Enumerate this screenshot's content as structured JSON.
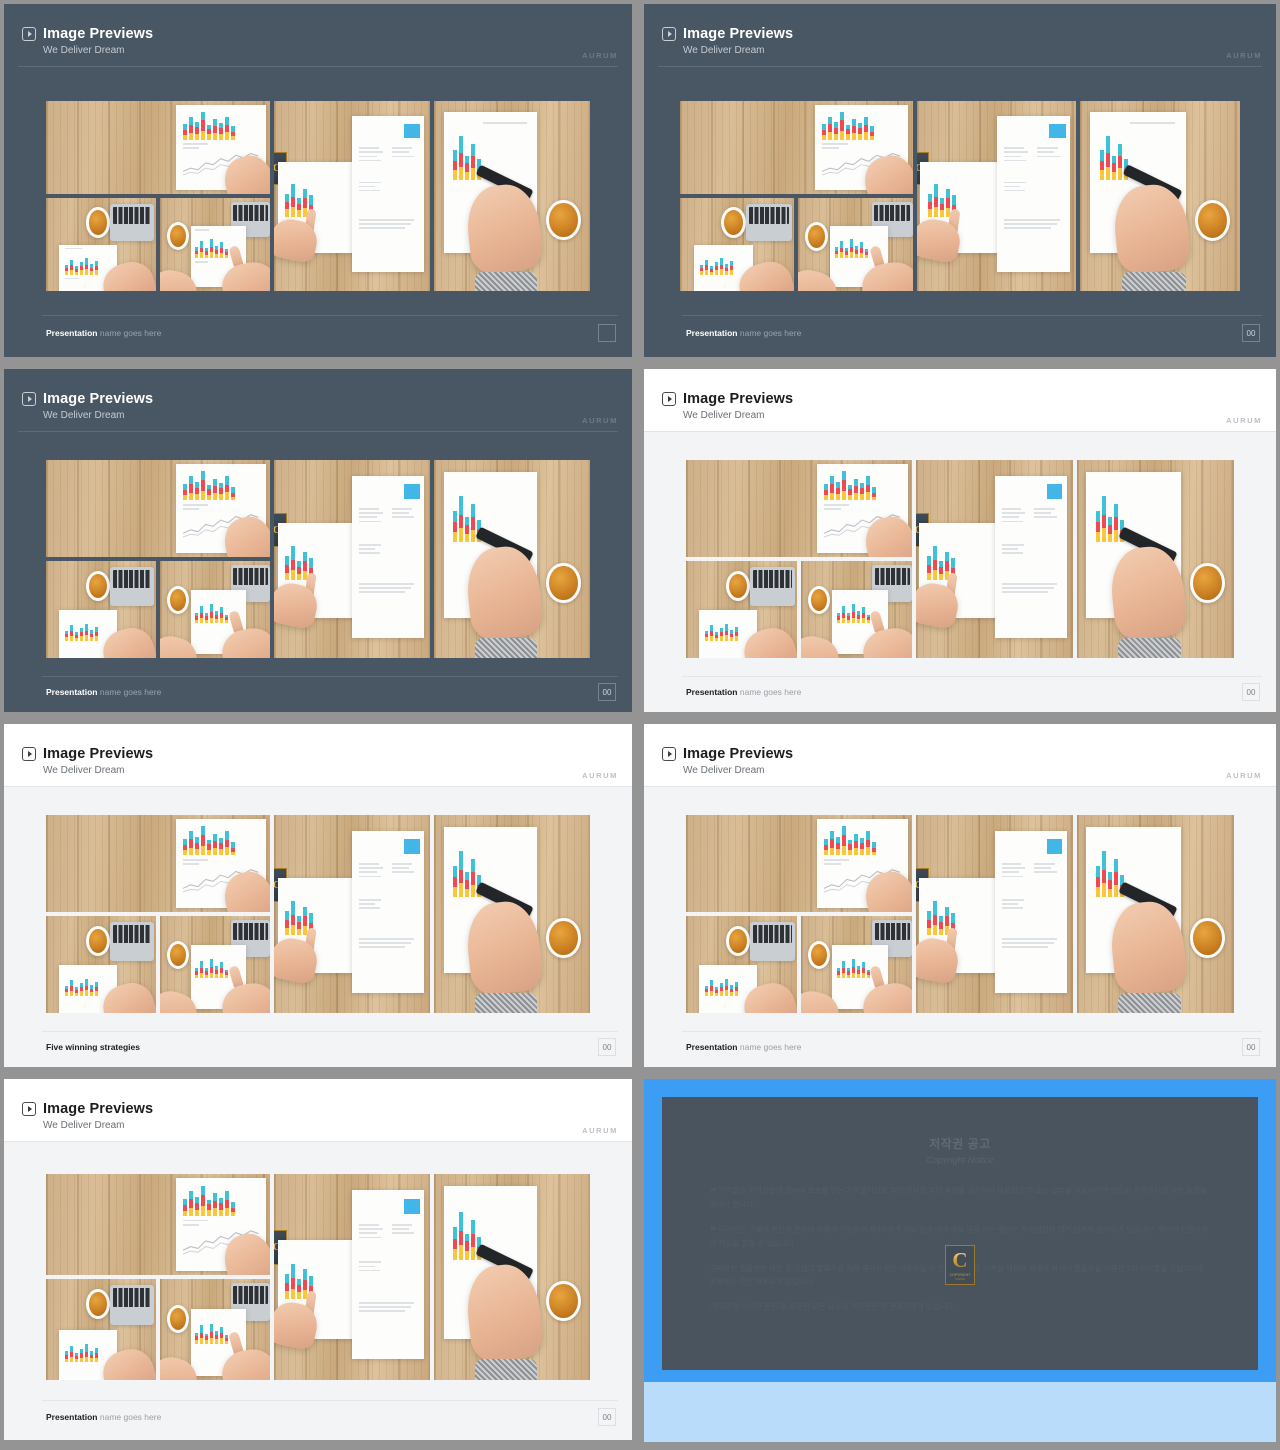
{
  "slides": [
    {
      "id": "slide-1",
      "theme": "dark",
      "title": "Image Previews",
      "subtitle": "We Deliver Dream",
      "brand": "AURUM",
      "footer_bold": "Presentation",
      "footer_normal": " name goes here",
      "page_number": ""
    },
    {
      "id": "slide-2",
      "theme": "dark",
      "title": "Image Previews",
      "subtitle": "We Deliver Dream",
      "brand": "AURUM",
      "footer_bold": "Presentation",
      "footer_normal": " name goes here",
      "page_number": "00"
    },
    {
      "id": "slide-3",
      "theme": "dark",
      "title": "Image Previews",
      "subtitle": "We Deliver Dream",
      "brand": "AURUM",
      "footer_bold": "Presentation",
      "footer_normal": " name goes here",
      "page_number": "00"
    },
    {
      "id": "slide-4",
      "theme": "light",
      "title": "Image Previews",
      "subtitle": "We Deliver Dream",
      "brand": "AURUM",
      "footer_bold": "Presentation",
      "footer_normal": " name goes here",
      "page_number": "00"
    },
    {
      "id": "slide-5",
      "theme": "light",
      "title": "Image Previews",
      "subtitle": "We Deliver Dream",
      "brand": "AURUM",
      "footer_bold": "Five winning strategies",
      "footer_normal": "",
      "page_number": "00"
    },
    {
      "id": "slide-6",
      "theme": "light",
      "title": "Image Previews",
      "subtitle": "We Deliver Dream",
      "brand": "AURUM",
      "footer_bold": "Presentation",
      "footer_normal": " name goes here",
      "page_number": "00"
    },
    {
      "id": "slide-7",
      "theme": "light",
      "title": "Image Previews",
      "subtitle": "We Deliver Dream",
      "brand": "AURUM",
      "footer_bold": "Presentation",
      "footer_normal": " name goes here",
      "page_number": "00"
    }
  ],
  "copyright": {
    "heading_ko": "저작권 공고",
    "heading_en": "Copyright Notice",
    "paragraphs": [
      "본 저작물은 저작권법에 의하여 보호를 받는 저작물이므로 무단 전재와 무단 복제를 금지하며 내용의 전부 또는 일부를 이용하려면 반드시 저작권자의 서면 동의를 받아야 합니다.",
      "본 디자인은 구매자 본인에 한하여 사용이 가능하며 제3자에게 양도 판매 대여 배포 공유 하는 행위는 저작권법에 의거 엄격히 금지되어 있습니다. 위반시 민형사상의 책임을 물을 수 있습니다.",
      "구매하신 템플릿은 개인 및 기업의 발표자료 제작 목적으로만 사용하실 수 있으며 템플릿 자체를 재판매 재배포 하거나 템플릿을 이용한 2차 저작물을 상업적으로 유통하는 것은 허용되지 않습니다.",
      "이미지 및 아이콘 폰트 등 포함된 모든 요소의 저작권은 각 권리자에게 있습니다."
    ],
    "logo_letter": "C",
    "logo_line1": "COPYRIGHT",
    "logo_line2": "AURUM"
  }
}
